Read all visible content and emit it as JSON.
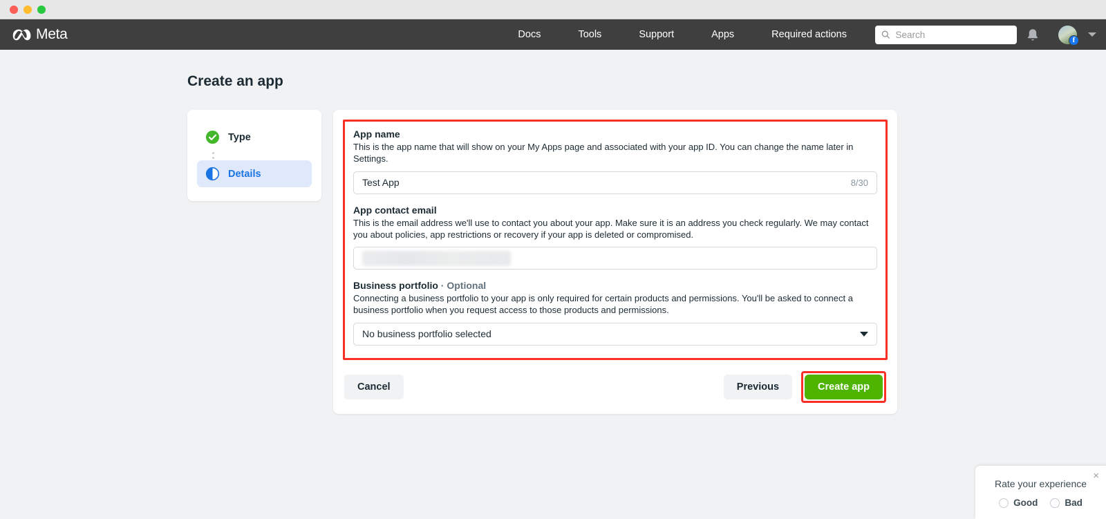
{
  "window": {
    "controls": [
      "close",
      "minimize",
      "maximize"
    ]
  },
  "topnav": {
    "brand": "Meta",
    "links": [
      {
        "label": "Docs"
      },
      {
        "label": "Tools"
      },
      {
        "label": "Support"
      },
      {
        "label": "Apps"
      },
      {
        "label": "Required actions"
      }
    ],
    "search": {
      "placeholder": "Search",
      "value": ""
    },
    "badge_letter": "f"
  },
  "page": {
    "title": "Create an app"
  },
  "stepper": {
    "steps": [
      {
        "label": "Type",
        "state": "complete"
      },
      {
        "label": "Details",
        "state": "current"
      }
    ]
  },
  "form": {
    "app_name": {
      "label": "App name",
      "description": "This is the app name that will show on your My Apps page and associated with your app ID. You can change the name later in Settings.",
      "value": "Test App",
      "placeholder": "",
      "counter": "8/30"
    },
    "contact_email": {
      "label": "App contact email",
      "description": "This is the email address we'll use to contact you about your app. Make sure it is an address you check regularly. We may contact you about policies, app restrictions or recovery if your app is deleted or compromised.",
      "value": "",
      "placeholder": "",
      "redacted": true
    },
    "business_portfolio": {
      "label": "Business portfolio",
      "optional_tag": "· Optional",
      "description": "Connecting a business portfolio to your app is only required for certain products and permissions. You'll be asked to connect a business portfolio when you request access to those products and permissions.",
      "selected": "No business portfolio selected"
    }
  },
  "actions": {
    "cancel": "Cancel",
    "previous": "Previous",
    "create": "Create app"
  },
  "feedback": {
    "title": "Rate your experience",
    "close": "×",
    "options": [
      {
        "label": "Good"
      },
      {
        "label": "Bad"
      }
    ]
  },
  "colors": {
    "nav_bg": "#3f3f3f",
    "page_bg": "#f1f2f3",
    "accent_blue": "#1b74e4",
    "step_complete_green": "#42b72a",
    "primary_green": "#4fb400",
    "annotation_red": "#fa2f26"
  }
}
